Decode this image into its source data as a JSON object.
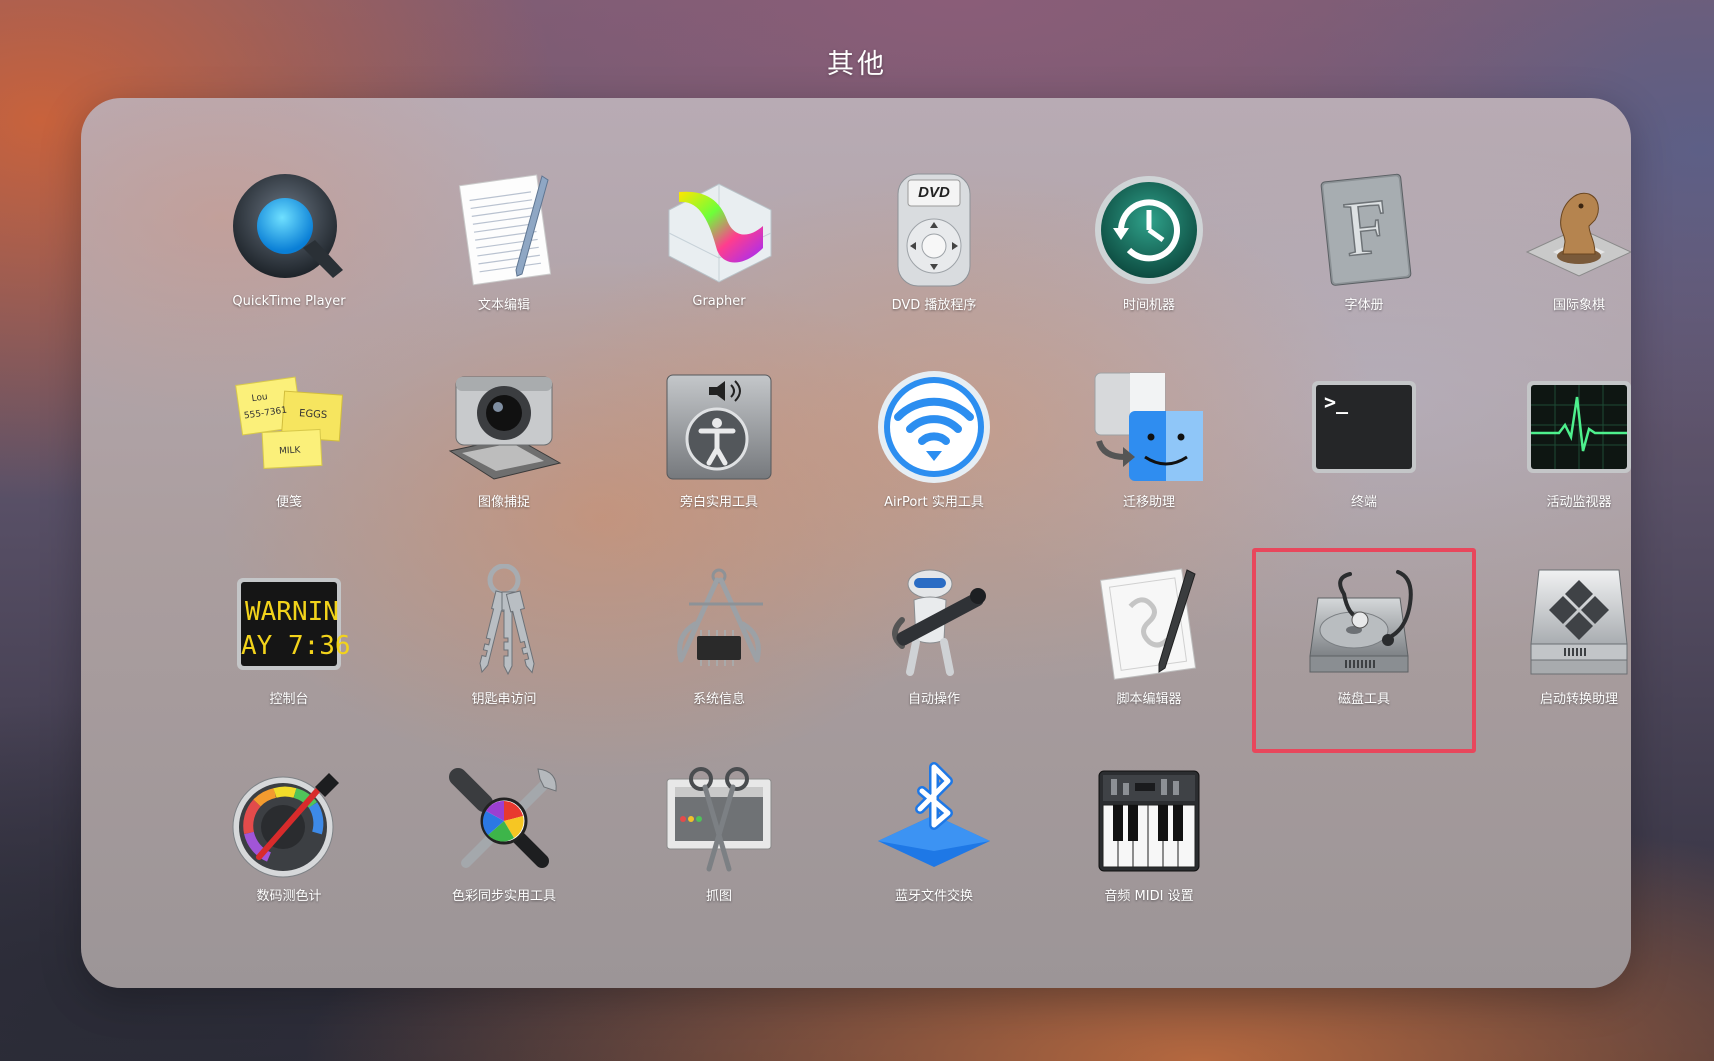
{
  "folder": {
    "title": "其他",
    "highlight_color": "#e8475c",
    "apps": [
      {
        "label": "QuickTime Player",
        "icon": "quicktime-icon"
      },
      {
        "label": "文本编辑",
        "icon": "textedit-icon"
      },
      {
        "label": "Grapher",
        "icon": "grapher-icon"
      },
      {
        "label": "DVD 播放程序",
        "icon": "dvd-player-icon"
      },
      {
        "label": "时间机器",
        "icon": "time-machine-icon"
      },
      {
        "label": "字体册",
        "icon": "font-book-icon"
      },
      {
        "label": "国际象棋",
        "icon": "chess-icon"
      },
      {
        "label": "便笺",
        "icon": "stickies-icon"
      },
      {
        "label": "图像捕捉",
        "icon": "image-capture-icon"
      },
      {
        "label": "旁白实用工具",
        "icon": "voiceover-utility-icon"
      },
      {
        "label": "AirPort 实用工具",
        "icon": "airport-utility-icon"
      },
      {
        "label": "迁移助理",
        "icon": "migration-assistant-icon"
      },
      {
        "label": "终端",
        "icon": "terminal-icon"
      },
      {
        "label": "活动监视器",
        "icon": "activity-monitor-icon"
      },
      {
        "label": "控制台",
        "icon": "console-icon",
        "icon_text": [
          "WARNIN",
          "AY 7:36"
        ]
      },
      {
        "label": "钥匙串访问",
        "icon": "keychain-access-icon"
      },
      {
        "label": "系统信息",
        "icon": "system-information-icon"
      },
      {
        "label": "自动操作",
        "icon": "automator-icon"
      },
      {
        "label": "脚本编辑器",
        "icon": "script-editor-icon"
      },
      {
        "label": "磁盘工具",
        "icon": "disk-utility-icon",
        "highlighted": true
      },
      {
        "label": "启动转换助理",
        "icon": "boot-camp-assistant-icon"
      },
      {
        "label": "数码测色计",
        "icon": "digital-color-meter-icon"
      },
      {
        "label": "色彩同步实用工具",
        "icon": "colorsync-utility-icon"
      },
      {
        "label": "抓图",
        "icon": "grab-icon"
      },
      {
        "label": "蓝牙文件交换",
        "icon": "bluetooth-file-exchange-icon"
      },
      {
        "label": "音频 MIDI 设置",
        "icon": "audio-midi-setup-icon"
      }
    ]
  }
}
